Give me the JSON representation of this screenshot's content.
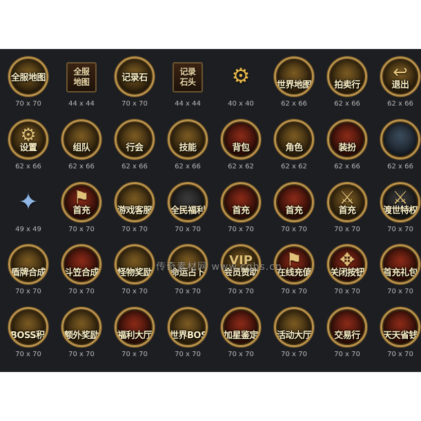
{
  "watermark": "传奇素材网 www.cqbs.cn",
  "rows": [
    [
      {
        "label": "全服地图",
        "size": "70 x 70",
        "icon": "world-map-icon"
      },
      {
        "label": "全服地图",
        "size": "44 x 44",
        "icon": "world-map-small-icon"
      },
      {
        "label": "记录石",
        "size": "70 x 70",
        "icon": "record-stone-icon"
      },
      {
        "label": "记录石头",
        "size": "44 x 44",
        "icon": "record-stone-small-icon"
      },
      {
        "label": "",
        "size": "40 x 40",
        "icon": "gear-icon"
      },
      {
        "label": "世界地图",
        "size": "62 x 66",
        "icon": "map-scroll-icon"
      },
      {
        "label": "拍卖行",
        "size": "62 x 66",
        "icon": "auction-book-icon"
      },
      {
        "label": "退出",
        "size": "62 x 66",
        "icon": "exit-arrow-icon"
      }
    ],
    [
      {
        "label": "设置",
        "size": "62 x 66",
        "icon": "settings-gear-icon"
      },
      {
        "label": "组队",
        "size": "62 x 66",
        "icon": "team-warrior-icon"
      },
      {
        "label": "行会",
        "size": "62 x 66",
        "icon": "guild-emblem-icon"
      },
      {
        "label": "技能",
        "size": "62 x 66",
        "icon": "skill-icon"
      },
      {
        "label": "背包",
        "size": "62 x 62",
        "icon": "bag-icon"
      },
      {
        "label": "角色",
        "size": "62 x 62",
        "icon": "character-icon"
      },
      {
        "label": "装扮",
        "size": "62 x 66",
        "icon": "outfit-armor-icon"
      },
      {
        "label": "",
        "size": "62 x 66",
        "icon": "blank-frame-icon"
      }
    ],
    [
      {
        "label": "",
        "size": "49 x 49",
        "icon": "crystal-star-icon"
      },
      {
        "label": "首充",
        "size": "70 x 70",
        "icon": "first-recharge-flag-icon"
      },
      {
        "label": "游戏客服",
        "size": "70 x 70",
        "icon": "support-book-icon"
      },
      {
        "label": "全民福利",
        "size": "70 x 70",
        "icon": "welfare-shield-icon"
      },
      {
        "label": "首充",
        "size": "70 x 70",
        "icon": "first-recharge-shield-icon"
      },
      {
        "label": "首充",
        "size": "70 x 70",
        "icon": "first-recharge-red-icon"
      },
      {
        "label": "首充",
        "size": "70 x 70",
        "icon": "first-recharge-swords-icon"
      },
      {
        "label": "渡世特权",
        "size": "70 x 70",
        "icon": "privilege-sword-icon"
      }
    ],
    [
      {
        "label": "盾牌合成",
        "size": "70 x 70",
        "icon": "shield-craft-icon"
      },
      {
        "label": "斗笠合成",
        "size": "70 x 70",
        "icon": "hat-craft-icon"
      },
      {
        "label": "怪物奖励",
        "size": "70 x 70",
        "icon": "monster-reward-icon"
      },
      {
        "label": "命运占卜",
        "size": "70 x 70",
        "icon": "fortune-book-icon"
      },
      {
        "label": "会员赞助",
        "size": "70 x 70",
        "icon": "vip-icon"
      },
      {
        "label": "在线充值",
        "size": "70 x 70",
        "icon": "online-recharge-icon"
      },
      {
        "label": "关闭按钮",
        "size": "70 x 70",
        "icon": "close-emblem-icon"
      },
      {
        "label": "首充礼包",
        "size": "70 x 70",
        "icon": "first-recharge-gift-icon"
      }
    ],
    [
      {
        "label": "BOSS积分",
        "size": "70 x 70",
        "icon": "boss-points-icon"
      },
      {
        "label": "额外奖励",
        "size": "70 x 70",
        "icon": "extra-reward-icon"
      },
      {
        "label": "福利大厅",
        "size": "70 x 70",
        "icon": "welfare-hall-icon"
      },
      {
        "label": "世界BOSS",
        "size": "70 x 70",
        "icon": "world-boss-icon"
      },
      {
        "label": "加星鉴定",
        "size": "70 x 70",
        "icon": "star-appraisal-icon"
      },
      {
        "label": "活动大厅",
        "size": "70 x 70",
        "icon": "event-hall-icon"
      },
      {
        "label": "交易行",
        "size": "70 x 70",
        "icon": "trading-house-icon"
      },
      {
        "label": "天天省钱",
        "size": "70 x 70",
        "icon": "daily-saving-icon"
      }
    ]
  ],
  "colors": {
    "background": "#1d1e22",
    "gold": "#b8914a",
    "caption": "#b8b8b8"
  }
}
